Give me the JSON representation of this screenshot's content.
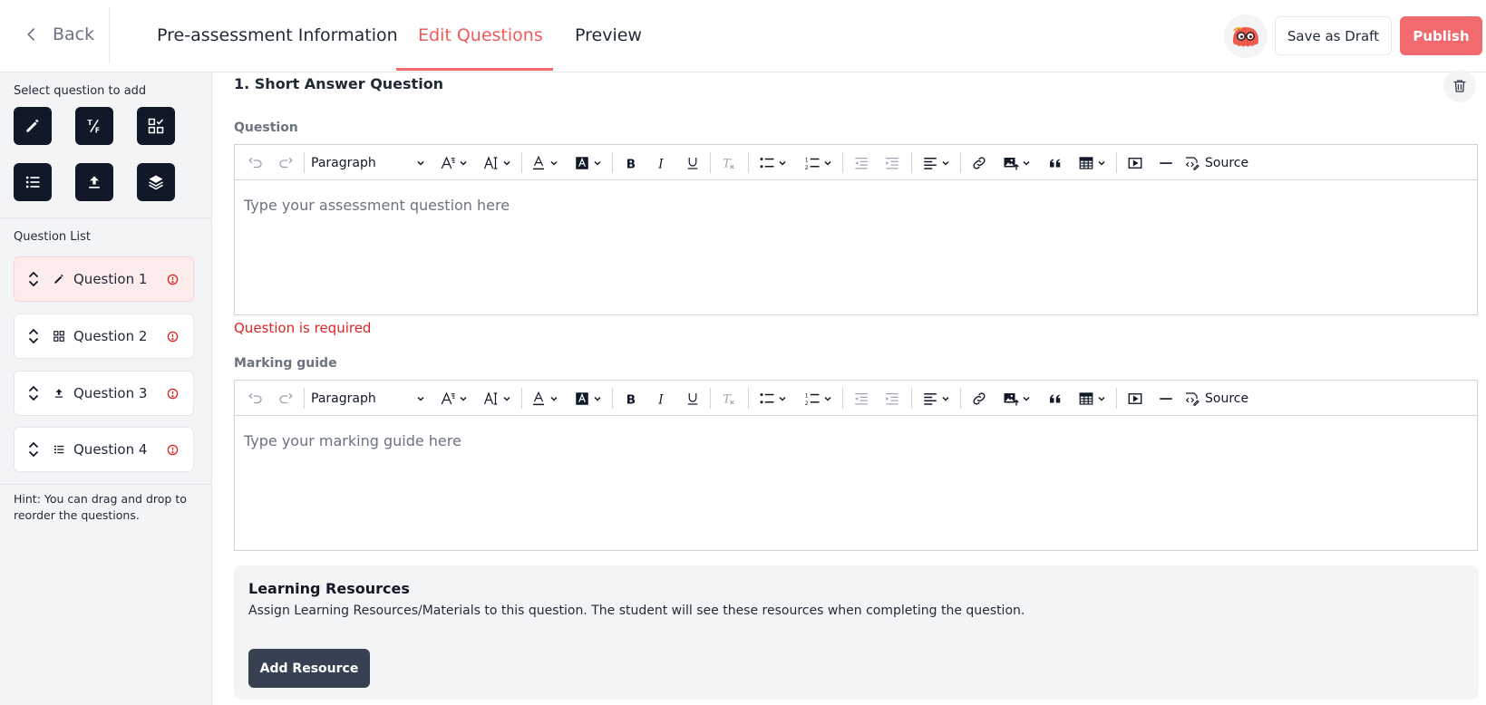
{
  "header": {
    "back_label": "Back",
    "tabs": [
      {
        "label": "Pre-assessment Information"
      },
      {
        "label": "Edit Questions"
      },
      {
        "label": "Preview"
      }
    ],
    "active_tab": "Edit Questions",
    "save_draft_label": "Save as Draft",
    "publish_label": "Publish"
  },
  "colors": {
    "accent": "#ef5b5b",
    "publish": "#f06a6e",
    "dark_button": "#111827",
    "error": "#dc2626",
    "sidebar_bg": "#f3f4f6"
  },
  "sidebar": {
    "select_title": "Select question to add",
    "question_types": [
      {
        "icon": "pencil-icon"
      },
      {
        "icon": "true-false-icon"
      },
      {
        "icon": "grid-check-icon"
      },
      {
        "icon": "list-icon"
      },
      {
        "icon": "upload-icon"
      },
      {
        "icon": "layers-icon"
      }
    ],
    "list_title": "Question List",
    "questions": [
      {
        "label": "Question 1",
        "icon": "pencil-icon",
        "active": true
      },
      {
        "label": "Question 2",
        "icon": "grid-icon",
        "active": false
      },
      {
        "label": "Question 3",
        "icon": "upload-icon",
        "active": false
      },
      {
        "label": "Question 4",
        "icon": "list-icon",
        "active": false
      }
    ],
    "hint": "Hint: You can drag and drop to reorder the questions."
  },
  "main": {
    "section_title": "1. Short Answer Question",
    "question_label": "Question",
    "question_placeholder": "Type your assessment question here",
    "question_error": "Question is required",
    "marking_label": "Marking guide",
    "marking_placeholder": "Type your marking guide here",
    "toolbar": {
      "paragraph": "Paragraph",
      "source": "Source"
    },
    "resources": {
      "title": "Learning Resources",
      "description": "Assign Learning Resources/Materials to this question. The student will see these resources when completing the question.",
      "add_label": "Add Resource"
    }
  }
}
